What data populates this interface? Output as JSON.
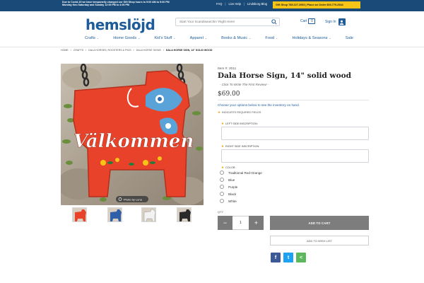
{
  "topbar": {
    "notice": "Due to Covid-19 we have temporarily changed our Gift Shop hours to 9:00 AM to 5:00 PM Monday thru Saturday and Sunday 12:00 PM to 4:00 PM",
    "links": [
      "FAQ",
      "Live Help",
      "Lindsborg Blog"
    ],
    "giftshop": "Gift Shop 785.227.2053 | Place an Order 800.779.2544"
  },
  "header": {
    "logo": "hemslöjd",
    "search_placeholder": "Start Your Scandisearchin' Right Here!",
    "cart_label": "Cart",
    "cart_count": "0",
    "signin_label": "Sign In"
  },
  "nav": {
    "items": [
      "Crafts",
      "Home Goods",
      "Kid's Stuff",
      "Apparel",
      "Books & Music",
      "Food",
      "Holidays & Seasons",
      "Sale"
    ]
  },
  "breadcrumb": [
    "Home",
    "Crafts",
    "Dala Horses, Roosters & Pigs",
    "Dala Horse Signs",
    "Dala Horse Sign, 14\" solid wood"
  ],
  "product": {
    "item_no": "Item #: 2011",
    "title": "Dala Horse Sign, 14\" solid wood",
    "review_link": "- Click To Write The First Review! -",
    "price": "$69.00",
    "choose_text": "Choose your options below to see the inventory on hand.",
    "required_note": "Indicates required fields",
    "image_text": "Välkommen",
    "image_badge": "Photo by Luna"
  },
  "options": {
    "left_label": "Left side inscription:",
    "right_label": "Right side inscription:",
    "color_label": "Color:",
    "colors": [
      "Traditional Red-Orange",
      "Blue",
      "Purple",
      "Black",
      "White"
    ]
  },
  "purchase": {
    "qty_label": "Qty",
    "qty_value": "1",
    "minus": "−",
    "plus": "+",
    "add_to_cart": "ADD TO CART",
    "wishlist": "ADD TO WISH LIST"
  },
  "social": {
    "facebook": "f",
    "twitter": "t",
    "share": "<"
  },
  "colors": {
    "primary": "#1e5c99",
    "topbar": "#1a4b78",
    "accent": "#f6c518",
    "horse": "#e8432a",
    "button_gray": "#7d7d7d",
    "facebook": "#3b5998",
    "twitter": "#1da1f2",
    "share": "#5cb85c"
  }
}
